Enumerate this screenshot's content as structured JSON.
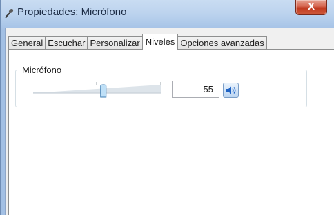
{
  "window": {
    "title": "Propiedades: Micrófono",
    "close_glyph": "X"
  },
  "tabs": [
    {
      "label": "General"
    },
    {
      "label": "Escuchar"
    },
    {
      "label": "Personalizar"
    },
    {
      "label": "Niveles",
      "active": true
    },
    {
      "label": "Opciones avanzadas"
    }
  ],
  "levels": {
    "group_label": "Micrófono",
    "slider_value_percent": 55,
    "value_text": "55",
    "mute_icon": "speaker-icon"
  },
  "colors": {
    "titlebar": "#bcd3ee",
    "close_button": "#c0391f",
    "speaker_icon": "#1f63c4"
  }
}
